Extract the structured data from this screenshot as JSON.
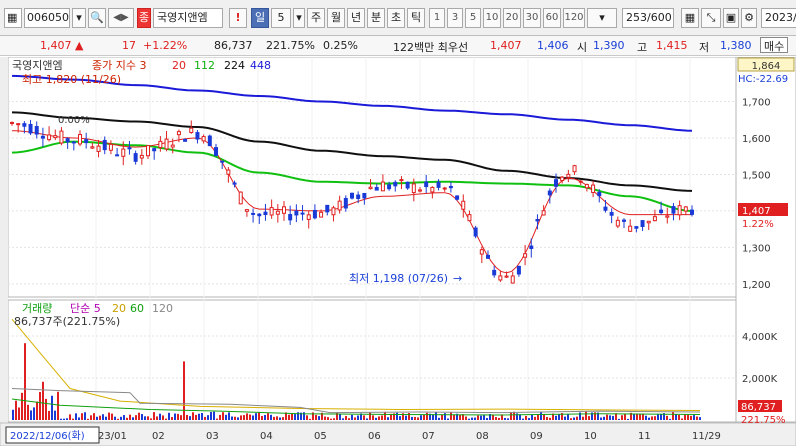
{
  "toolbar": {
    "stock_code": "006050",
    "search_glyph": "🔍",
    "arrows_glyph": "◀▶",
    "stock_tag": "종",
    "stock_name": "국영지앤엠",
    "alert": "!",
    "period_day": "일",
    "period_count": "5",
    "period_week": "주",
    "period_month": "월",
    "period_year": "년",
    "period_min": "분",
    "period_sec": "초",
    "period_tick": "틱",
    "intervals": [
      "1",
      "3",
      "5",
      "10",
      "20",
      "30",
      "60",
      "120"
    ],
    "page_counter": "253/600",
    "date_value": "2023/",
    "accent": "#4a6fb5"
  },
  "price_bar": {
    "price": "1,407",
    "change_arrow": "▲",
    "change": "17",
    "change_pct": "+1.22%",
    "volume": "86,737",
    "volume_ratio": "221.75%",
    "turnover": "0.25%",
    "note": "122백만 최우선",
    "ask": "1,407",
    "bid": "1,406",
    "open_label": "시",
    "open": "1,390",
    "high_label": "고",
    "high": "1,415",
    "low_label": "저",
    "low": "1,380",
    "buy_label": "매수"
  },
  "chart_data": [
    {
      "type": "line",
      "panel": "price",
      "title": "국영지앤엠",
      "legend": [
        "종가 지수 3",
        "20",
        "112",
        "224",
        "448"
      ],
      "series_colors": {
        "price": "#1e2bd6",
        "ma20": "#e02020",
        "ma112": "#10c010",
        "ma224": "#101010",
        "ma448": "#1a1ad8"
      },
      "y_ticks": [
        "1,700",
        "1,600",
        "1,500",
        "1,400",
        "1,300",
        "1,200"
      ],
      "ylim": [
        1175,
        1800
      ],
      "high_note": "최고 1,820 (11/26)",
      "low_note": "최저 1,198 (07/26)",
      "top_label": "1,864",
      "hc_label": "HC:-22.69",
      "mid_note": "0.00%",
      "current_price": "1,407",
      "current_pct": "1.22%",
      "x": [
        "12/06",
        "01",
        "02",
        "03",
        "04",
        "05",
        "06",
        "07",
        "08",
        "09",
        "10",
        "11",
        "11/29"
      ],
      "ma448": [
        1770,
        1760,
        1745,
        1730,
        1715,
        1700,
        1688,
        1675,
        1665,
        1650,
        1635,
        1620
      ],
      "ma224": [
        1670,
        1655,
        1645,
        1630,
        1590,
        1565,
        1550,
        1540,
        1510,
        1490,
        1470,
        1455
      ],
      "ma112": [
        1560,
        1590,
        1580,
        1560,
        1505,
        1480,
        1475,
        1480,
        1475,
        1470,
        1440,
        1400
      ],
      "ma20": [
        1620,
        1600,
        1575,
        1600,
        1405,
        1400,
        1440,
        1450,
        1230,
        1490,
        1390,
        1390
      ],
      "price": [
        1640,
        1595,
        1555,
        1615,
        1390,
        1395,
        1470,
        1460,
        1215,
        1510,
        1360,
        1407
      ]
    },
    {
      "type": "bar",
      "panel": "volume",
      "legend": [
        "거래량",
        "단순 5",
        "20",
        "60",
        "120"
      ],
      "current_label": "86,737주(221.75%)",
      "y_ticks": [
        "4,000K",
        "2,000K"
      ],
      "ylim": [
        0,
        5000000
      ],
      "volume_label": "86,737",
      "volume_pct_label": "221.75%",
      "colors": {
        "up": "#e02020",
        "down": "#1a3ad8",
        "ma5": "#b000b0",
        "ma20": "#d8b000",
        "ma60": "#10a010",
        "ma120": "#888888"
      }
    }
  ],
  "x_axis": {
    "labels": [
      "23/01",
      "02",
      "03",
      "04",
      "05",
      "06",
      "07",
      "08",
      "09",
      "10",
      "11",
      "11/29"
    ],
    "cursor_date": "2022/12/06(화)"
  }
}
